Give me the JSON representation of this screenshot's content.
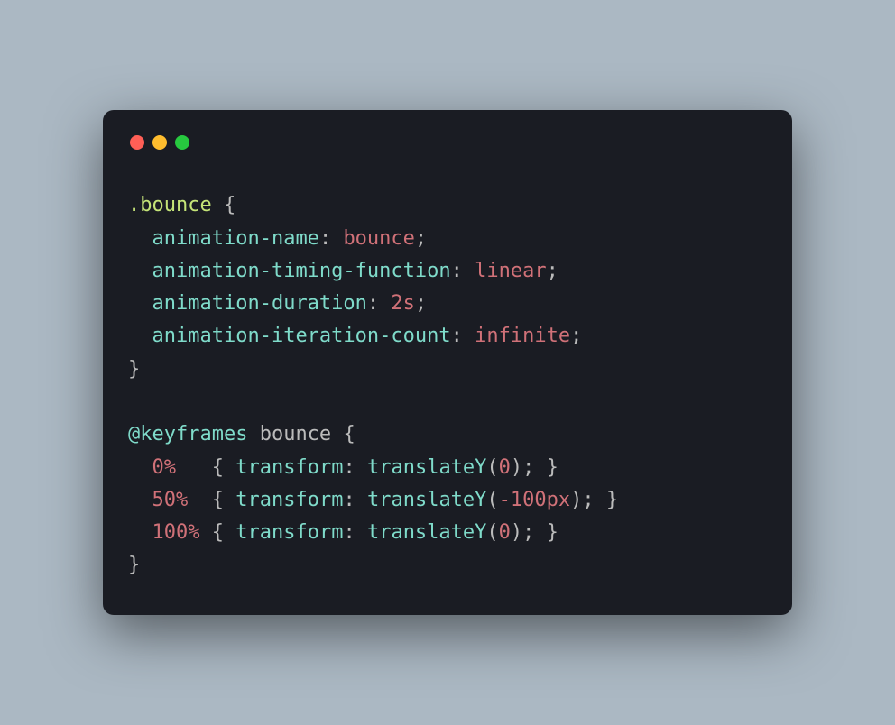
{
  "code": {
    "selector": ".bounce",
    "rules": [
      {
        "prop": "animation-name",
        "value": "bounce"
      },
      {
        "prop": "animation-timing-function",
        "value": "linear"
      },
      {
        "prop": "animation-duration",
        "value": "2s"
      },
      {
        "prop": "animation-iteration-count",
        "value": "infinite"
      }
    ],
    "atrule": "@keyframes",
    "keyframename": "bounce",
    "keyframes": [
      {
        "percent": "0%",
        "pad": "  ",
        "func": "translateY",
        "arg": "0"
      },
      {
        "percent": "50%",
        "pad": " ",
        "func": "translateY",
        "arg": "-100px"
      },
      {
        "percent": "100%",
        "pad": "",
        "func": "translateY",
        "arg": "0"
      }
    ],
    "transform_prop": "transform",
    "punc": {
      "openbrace": "{",
      "closebrace": "}",
      "colon": ":",
      "semicolon": ";",
      "openparen": "(",
      "closeparen": ")",
      "space": " "
    }
  }
}
